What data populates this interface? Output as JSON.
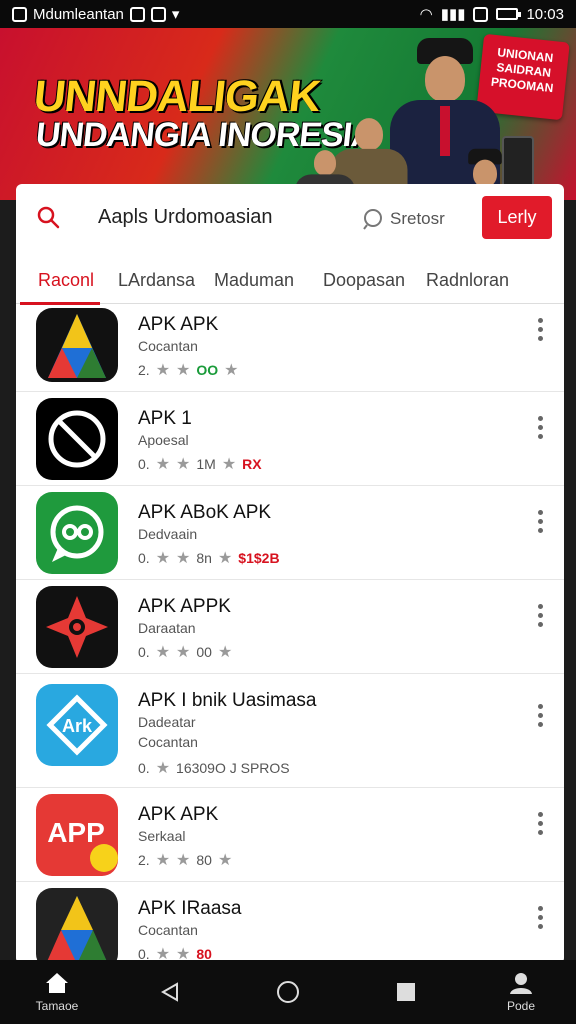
{
  "status_bar": {
    "app_name": "Mdumleantan",
    "time": "10:03"
  },
  "banner": {
    "title_line1": "UNNDALIGAK",
    "title_line2": "UNDANGIA INORESIA",
    "badge_text": "UNIONAN SAIDRAN PROOMAN"
  },
  "search": {
    "query": "Aapls Urdomoasian",
    "voice_label": "Sretosr",
    "language_button": "Lerly"
  },
  "tabs": [
    "Raconl",
    "LArdansa",
    "Maduman",
    "Doopasan",
    "Radnloran"
  ],
  "apps": [
    {
      "name": "APK APK",
      "category": "Cocantan",
      "rating": "2.",
      "meta": "OO",
      "meta_color": "green"
    },
    {
      "name": "APK 1",
      "category": "Apoesal",
      "rating": "0.",
      "meta": "1M",
      "meta_extra": "RX",
      "meta_color": "red"
    },
    {
      "name": "APK ABoK APK",
      "category": "Dedvaain",
      "rating": "0.",
      "meta": "8n",
      "meta_extra": "$1$2B",
      "meta_color": "red"
    },
    {
      "name": "APK APPK",
      "category": "Daraatan",
      "rating": "0.",
      "meta": "00",
      "meta_color": "none"
    },
    {
      "name": "APK I bnik Uasimasa",
      "category": "Dadeatar",
      "category2": "Cocantan",
      "rating": "0.",
      "meta": "16309O J SPROS",
      "meta_color": "none"
    },
    {
      "name": "APK APK",
      "category": "Serkaal",
      "rating": "2.",
      "meta": "80",
      "meta_color": "none"
    },
    {
      "name": "APK IRaasa",
      "category": "Cocantan",
      "rating": "0.",
      "meta": "80",
      "meta_color": "red"
    }
  ],
  "icons": {
    "app1": "colorful-A-icon",
    "app2": "no-symbol-icon",
    "app3": "chat-bubble-icon",
    "app4": "star-shuriken-icon",
    "app5": "blue-tag-icon",
    "app6": "app-badge-icon",
    "app7": "colorful-A-icon"
  },
  "bottom_nav": {
    "home_label": "Tamaoe",
    "profile_label": "Pode"
  }
}
